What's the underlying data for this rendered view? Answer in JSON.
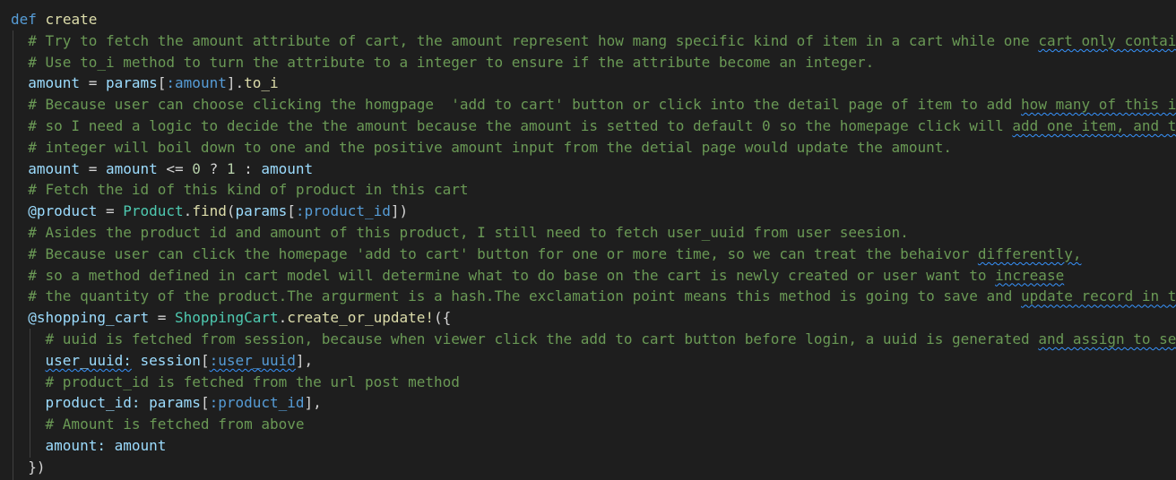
{
  "editor": {
    "lines": [
      [
        {
          "t": "def",
          "c": "kw"
        },
        {
          "t": " "
        },
        {
          "t": "create",
          "c": "fn"
        }
      ],
      [
        {
          "t": "  "
        },
        {
          "t": "# Try to fetch the amount attribute of cart, the amount represent how mang specific kind of item in a cart while one ",
          "c": "cm"
        },
        {
          "t": "cart only contai",
          "c": "cm",
          "sq": true
        }
      ],
      [
        {
          "t": "  "
        },
        {
          "t": "# Use to_i method to turn the attribute to a integer to ensure if the attribute become an integer.",
          "c": "cm"
        }
      ],
      [
        {
          "t": "  "
        },
        {
          "t": "amount",
          "c": "var"
        },
        {
          "t": " = ",
          "c": "op"
        },
        {
          "t": "params",
          "c": "var"
        },
        {
          "t": "[",
          "c": "op"
        },
        {
          "t": ":amount",
          "c": "sym"
        },
        {
          "t": "].",
          "c": "op"
        },
        {
          "t": "to_i",
          "c": "fn"
        }
      ],
      [
        {
          "t": "  "
        },
        {
          "t": "# Because user can choose clicking the homgpage  'add to cart' button or click into the detail page of item to add ",
          "c": "cm"
        },
        {
          "t": "how many of this i",
          "c": "cm",
          "sq": true
        }
      ],
      [
        {
          "t": "  "
        },
        {
          "t": "# so I need a logic to decide the the amount because the amount is setted to default 0 so the homepage click will ",
          "c": "cm"
        },
        {
          "t": "add one item, and t",
          "c": "cm",
          "sq": true
        }
      ],
      [
        {
          "t": "  "
        },
        {
          "t": "# integer will boil down to one and the positive amount input from the detial page would update the amount.",
          "c": "cm"
        }
      ],
      [
        {
          "t": "  "
        },
        {
          "t": "amount",
          "c": "var"
        },
        {
          "t": " = ",
          "c": "op"
        },
        {
          "t": "amount",
          "c": "var"
        },
        {
          "t": " <= ",
          "c": "op"
        },
        {
          "t": "0",
          "c": "num"
        },
        {
          "t": " ? ",
          "c": "op"
        },
        {
          "t": "1",
          "c": "num"
        },
        {
          "t": " : ",
          "c": "op"
        },
        {
          "t": "amount",
          "c": "var"
        }
      ],
      [
        {
          "t": "  "
        },
        {
          "t": "# Fetch the id of this kind of product in this cart",
          "c": "cm"
        }
      ],
      [
        {
          "t": "  "
        },
        {
          "t": "@product",
          "c": "var"
        },
        {
          "t": " = ",
          "c": "op"
        },
        {
          "t": "Product",
          "c": "cls"
        },
        {
          "t": ".",
          "c": "op"
        },
        {
          "t": "find",
          "c": "fn"
        },
        {
          "t": "(",
          "c": "op"
        },
        {
          "t": "params",
          "c": "var"
        },
        {
          "t": "[",
          "c": "op"
        },
        {
          "t": ":product_id",
          "c": "sym"
        },
        {
          "t": "])",
          "c": "op"
        }
      ],
      [
        {
          "t": "  "
        },
        {
          "t": "# Asides the product id and amount of this product, I still need to fetch user_uuid from user seesion.",
          "c": "cm"
        }
      ],
      [
        {
          "t": "  "
        },
        {
          "t": "# Because user can click the homepage 'add to cart' button for one or more time, so we can treat the behaivor ",
          "c": "cm"
        },
        {
          "t": "differently,",
          "c": "cm",
          "sq": true
        }
      ],
      [
        {
          "t": "  "
        },
        {
          "t": "# so a method defined in cart model will determine what to do base on the cart is newly created or user want to ",
          "c": "cm"
        },
        {
          "t": "increase",
          "c": "cm",
          "sq": true
        }
      ],
      [
        {
          "t": "  "
        },
        {
          "t": "# the quantity of the product.The argurment is a hash.The exclamation point means this method is going to save and ",
          "c": "cm"
        },
        {
          "t": "update record in t",
          "c": "cm",
          "sq": true
        }
      ],
      [
        {
          "t": "  "
        },
        {
          "t": "@shopping_cart",
          "c": "var"
        },
        {
          "t": " = ",
          "c": "op"
        },
        {
          "t": "ShoppingCart",
          "c": "cls"
        },
        {
          "t": ".",
          "c": "op"
        },
        {
          "t": "create_or_update!",
          "c": "fn"
        },
        {
          "t": "({",
          "c": "op"
        }
      ],
      [
        {
          "t": "    "
        },
        {
          "t": "# uuid is fetched from session, because when viewer click the add to cart button before login, a uuid is generated ",
          "c": "cm"
        },
        {
          "t": "and assign to se",
          "c": "cm",
          "sq": true
        }
      ],
      [
        {
          "t": "    "
        },
        {
          "t": "user_uuid:",
          "c": "var",
          "sq": true
        },
        {
          "t": " "
        },
        {
          "t": "session",
          "c": "var"
        },
        {
          "t": "[",
          "c": "op"
        },
        {
          "t": ":user_uuid",
          "c": "sym",
          "sq": true
        },
        {
          "t": "],",
          "c": "op"
        }
      ],
      [
        {
          "t": "    "
        },
        {
          "t": "# product_id is fetched from the url post method",
          "c": "cm"
        }
      ],
      [
        {
          "t": "    "
        },
        {
          "t": "product_id:",
          "c": "var"
        },
        {
          "t": " "
        },
        {
          "t": "params",
          "c": "var"
        },
        {
          "t": "[",
          "c": "op"
        },
        {
          "t": ":product_id",
          "c": "sym"
        },
        {
          "t": "],",
          "c": "op"
        }
      ],
      [
        {
          "t": "    "
        },
        {
          "t": "# Amount is fetched from above",
          "c": "cm"
        }
      ],
      [
        {
          "t": "    "
        },
        {
          "t": "amount:",
          "c": "var"
        },
        {
          "t": " "
        },
        {
          "t": "amount",
          "c": "var"
        }
      ],
      [
        {
          "t": "  "
        },
        {
          "t": "})",
          "c": "op"
        }
      ]
    ]
  }
}
